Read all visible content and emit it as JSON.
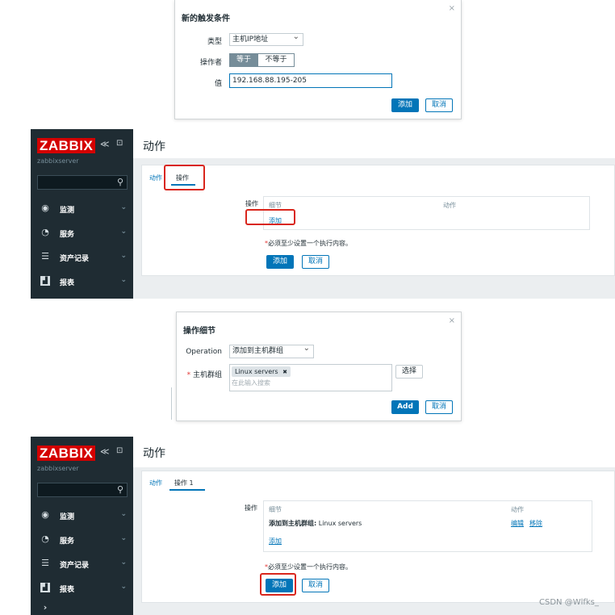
{
  "dialog1": {
    "title": "新的触发条件",
    "close": "×",
    "type_label": "类型",
    "type_value": "主机IP地址",
    "operator_label": "操作者",
    "operator_options": [
      "等于",
      "不等于"
    ],
    "value_label": "值",
    "value_input": "192.168.88.195-205",
    "add_button": "添加",
    "cancel_button": "取消"
  },
  "screen1": {
    "logo": "ZABBIX",
    "collapse_icon": "≪",
    "kiosk_icon": "⊡",
    "server": "zabbixserver",
    "menu": [
      {
        "icon": "eye-icon",
        "label": "监测"
      },
      {
        "icon": "clock-icon",
        "label": "服务"
      },
      {
        "icon": "list-icon",
        "label": "资产记录"
      },
      {
        "icon": "chart-icon",
        "label": "报表"
      }
    ],
    "page_title": "动作",
    "tabs": [
      "动作",
      "操作"
    ],
    "operations_label": "操作",
    "col_details": "细节",
    "col_action": "动作",
    "add_link": "添加",
    "note_marker": "*",
    "note": "必须至少设置一个执行内容。",
    "add_button": "添加",
    "cancel_button": "取消"
  },
  "dialog2": {
    "title": "操作细节",
    "close": "×",
    "operation_label": "Operation",
    "operation_value": "添加到主机群组",
    "hostgroup_required": "*",
    "hostgroup_label": "主机群组",
    "tag": "Linux servers",
    "tag_remove": "✖",
    "search_placeholder": "在此输入搜索",
    "select_button": "选择",
    "add_button": "Add",
    "cancel_button": "取消"
  },
  "screen2": {
    "logo": "ZABBIX",
    "collapse_icon": "≪",
    "kiosk_icon": "⊡",
    "server": "zabbixserver",
    "menu": [
      {
        "icon": "eye-icon",
        "label": "监测"
      },
      {
        "icon": "clock-icon",
        "label": "服务"
      },
      {
        "icon": "list-icon",
        "label": "资产记录"
      },
      {
        "icon": "chart-icon",
        "label": "报表"
      }
    ],
    "page_title": "动作",
    "tabs": [
      "动作",
      "操作 1"
    ],
    "operations_label": "操作",
    "col_details": "细节",
    "col_action": "动作",
    "row_detail_bold": "添加到主机群组:",
    "row_detail_value": "Linux servers",
    "row_edit": "编辑",
    "row_remove": "移除",
    "add_link": "添加",
    "note_marker": "*",
    "note": "必须至少设置一个执行内容。",
    "add_button": "添加",
    "cancel_button": "取消"
  },
  "watermark": "CSDN @Wlfks_"
}
